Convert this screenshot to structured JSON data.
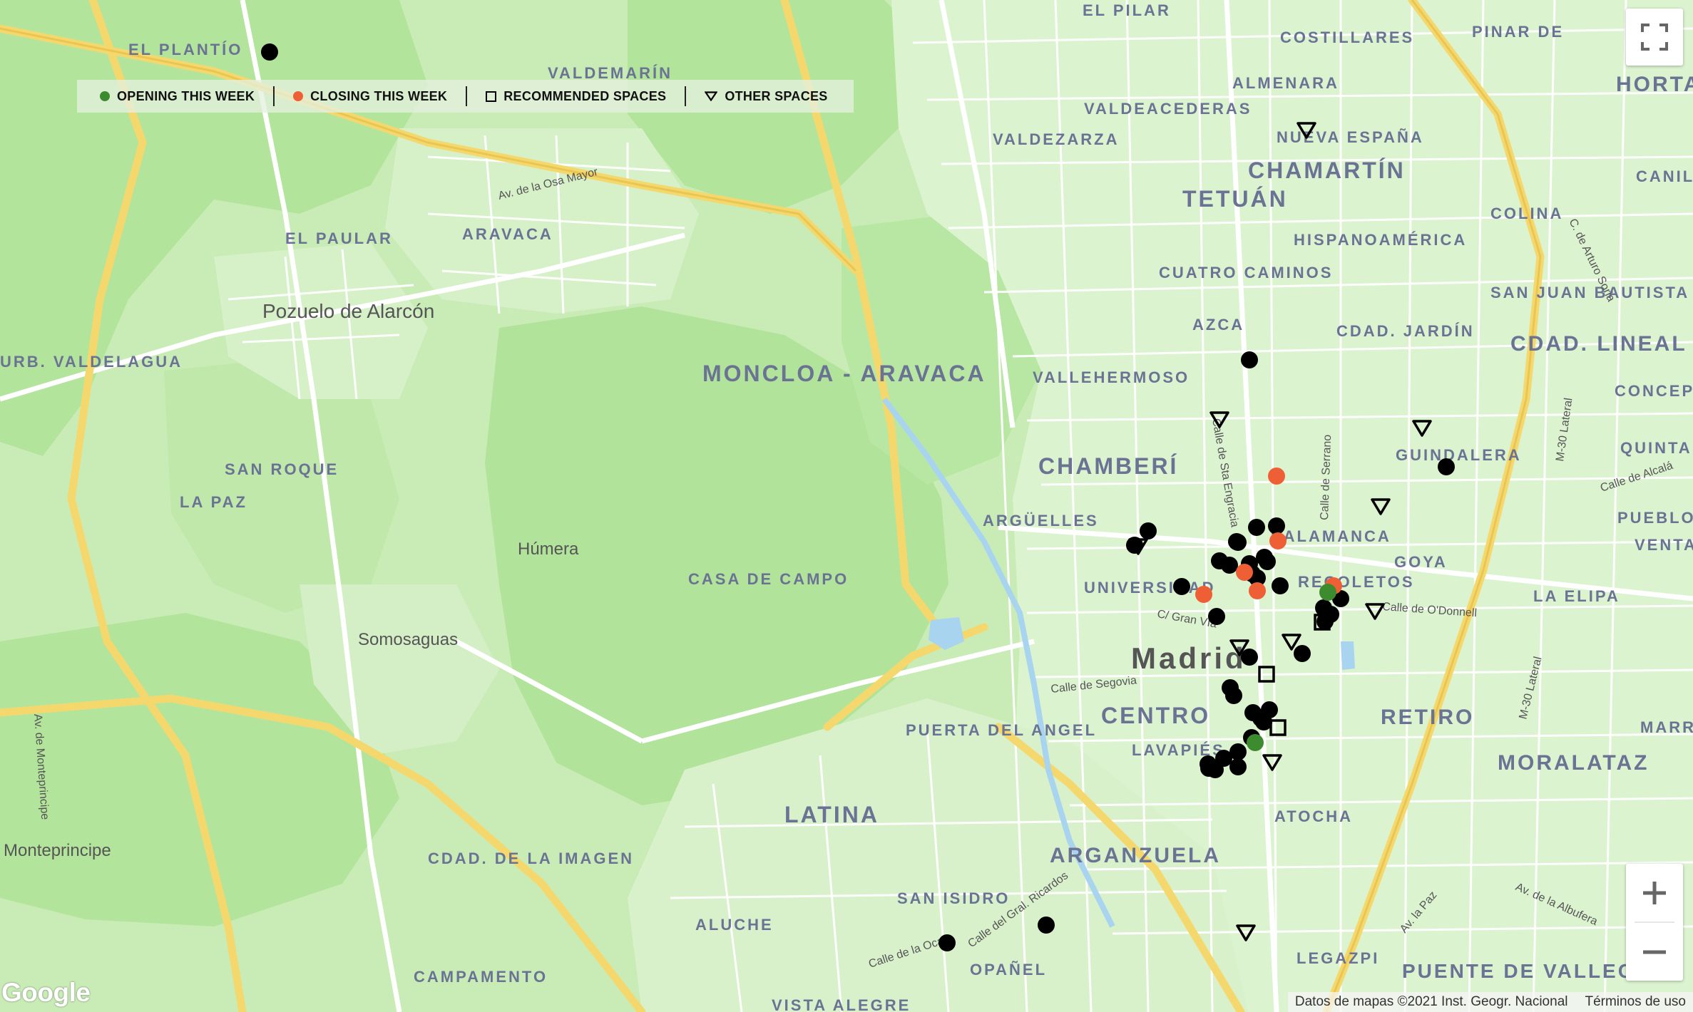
{
  "colors": {
    "map_park": "#b8e6a4",
    "map_green": "#cdeebb",
    "map_urban": "#dcf2cf",
    "road_white": "#ffffff",
    "highway": "#f6dc7a",
    "water": "#a8d4f0",
    "district_label": "#6b7394",
    "place_label": "#555555",
    "marker_black": "#000000",
    "marker_green": "#3d8b2f",
    "marker_orange": "#ef5f35"
  },
  "legend": {
    "items": [
      {
        "label": "OPENING THIS WEEK",
        "icon": "green-dot-icon",
        "color": "#3d8b2f"
      },
      {
        "label": "CLOSING THIS WEEK",
        "icon": "orange-dot-icon",
        "color": "#ef5f35"
      },
      {
        "label": "RECOMMENDED SPACES",
        "icon": "square-icon",
        "color": "#000000"
      },
      {
        "label": "OTHER SPACES",
        "icon": "triangle-icon",
        "color": "#000000"
      }
    ]
  },
  "map": {
    "district_labels": [
      "EL PILAR",
      "COSTILLARES",
      "PINAR DE",
      "HORTA",
      "EL PLANTÍO",
      "VALDEMARÍN",
      "ALMENARA",
      "VALDEACEDERAS",
      "VALDEZARZA",
      "NUEVA ESPAÑA",
      "CHAMARTÍN",
      "TETUÁN",
      "CANILL",
      "EL PAULAR",
      "ARAVACA",
      "HISPANOAMÉRICA",
      "COLINA",
      "CUATRO CAMINOS",
      "SAN JUAN BAUTISTA",
      "AZCA",
      "CDAD. JARDÍN",
      "CDAD. LINEAL",
      "URB. VALDELAGUA",
      "MONCLOA - ARAVACA",
      "VALLEHERMOSO",
      "CONCEPC",
      "QUINTANA",
      "SAN ROQUE",
      "CHAMBERÍ",
      "GUINDALERA",
      "LA PAZ",
      "PUEBLO N",
      "VENTAS",
      "ARGÜELLES",
      "SALAMANCA",
      "UNIVERSIDAD",
      "RECOLETOS",
      "GOYA",
      "CASA DE CAMPO",
      "LA ELIPA",
      "MARROQ",
      "CENTRO",
      "RETIRO",
      "PUERTA DEL ANGEL",
      "LAVAPIÉS",
      "MORALATAZ",
      "LATINA",
      "ATOCHA",
      "ARGANZUELA",
      "CDAD. DE LA IMAGEN",
      "SAN ISIDRO",
      "ALUCHE",
      "OPAÑEL",
      "CAMPAMENTO",
      "LEGAZPI",
      "PUENTE DE VALLECAS",
      "VISTA ALEGRE"
    ],
    "place_labels": [
      "Pozuelo de Alarcón",
      "Húmera",
      "Somosaguas",
      "Monteprincipe",
      "Madrid"
    ],
    "street_labels": [
      "Av. de la Osa Mayor",
      "Calle de Sta Engracia",
      "Calle de Serrano",
      "C. de Arturo Soria",
      "M-30 Lateral",
      "Calle de Alcalá",
      "C/ Gran Vía",
      "Calle de O'Donnell",
      "Calle de Segovia",
      "Av. de Monteprincipe",
      "M-30 Lateral",
      "Av. la Paz",
      "Av. de la Albufera",
      "Calle del Gral. Ricardos",
      "Calle de la Oca"
    ]
  },
  "controls": {
    "fullscreen": "fullscreen-icon",
    "zoom_in": "plus-icon",
    "zoom_out": "minus-icon"
  },
  "footer": {
    "logo": "Google",
    "attribution": "Datos de mapas ©2021 Inst. Geogr. Nacional",
    "terms": "Términos de uso"
  }
}
